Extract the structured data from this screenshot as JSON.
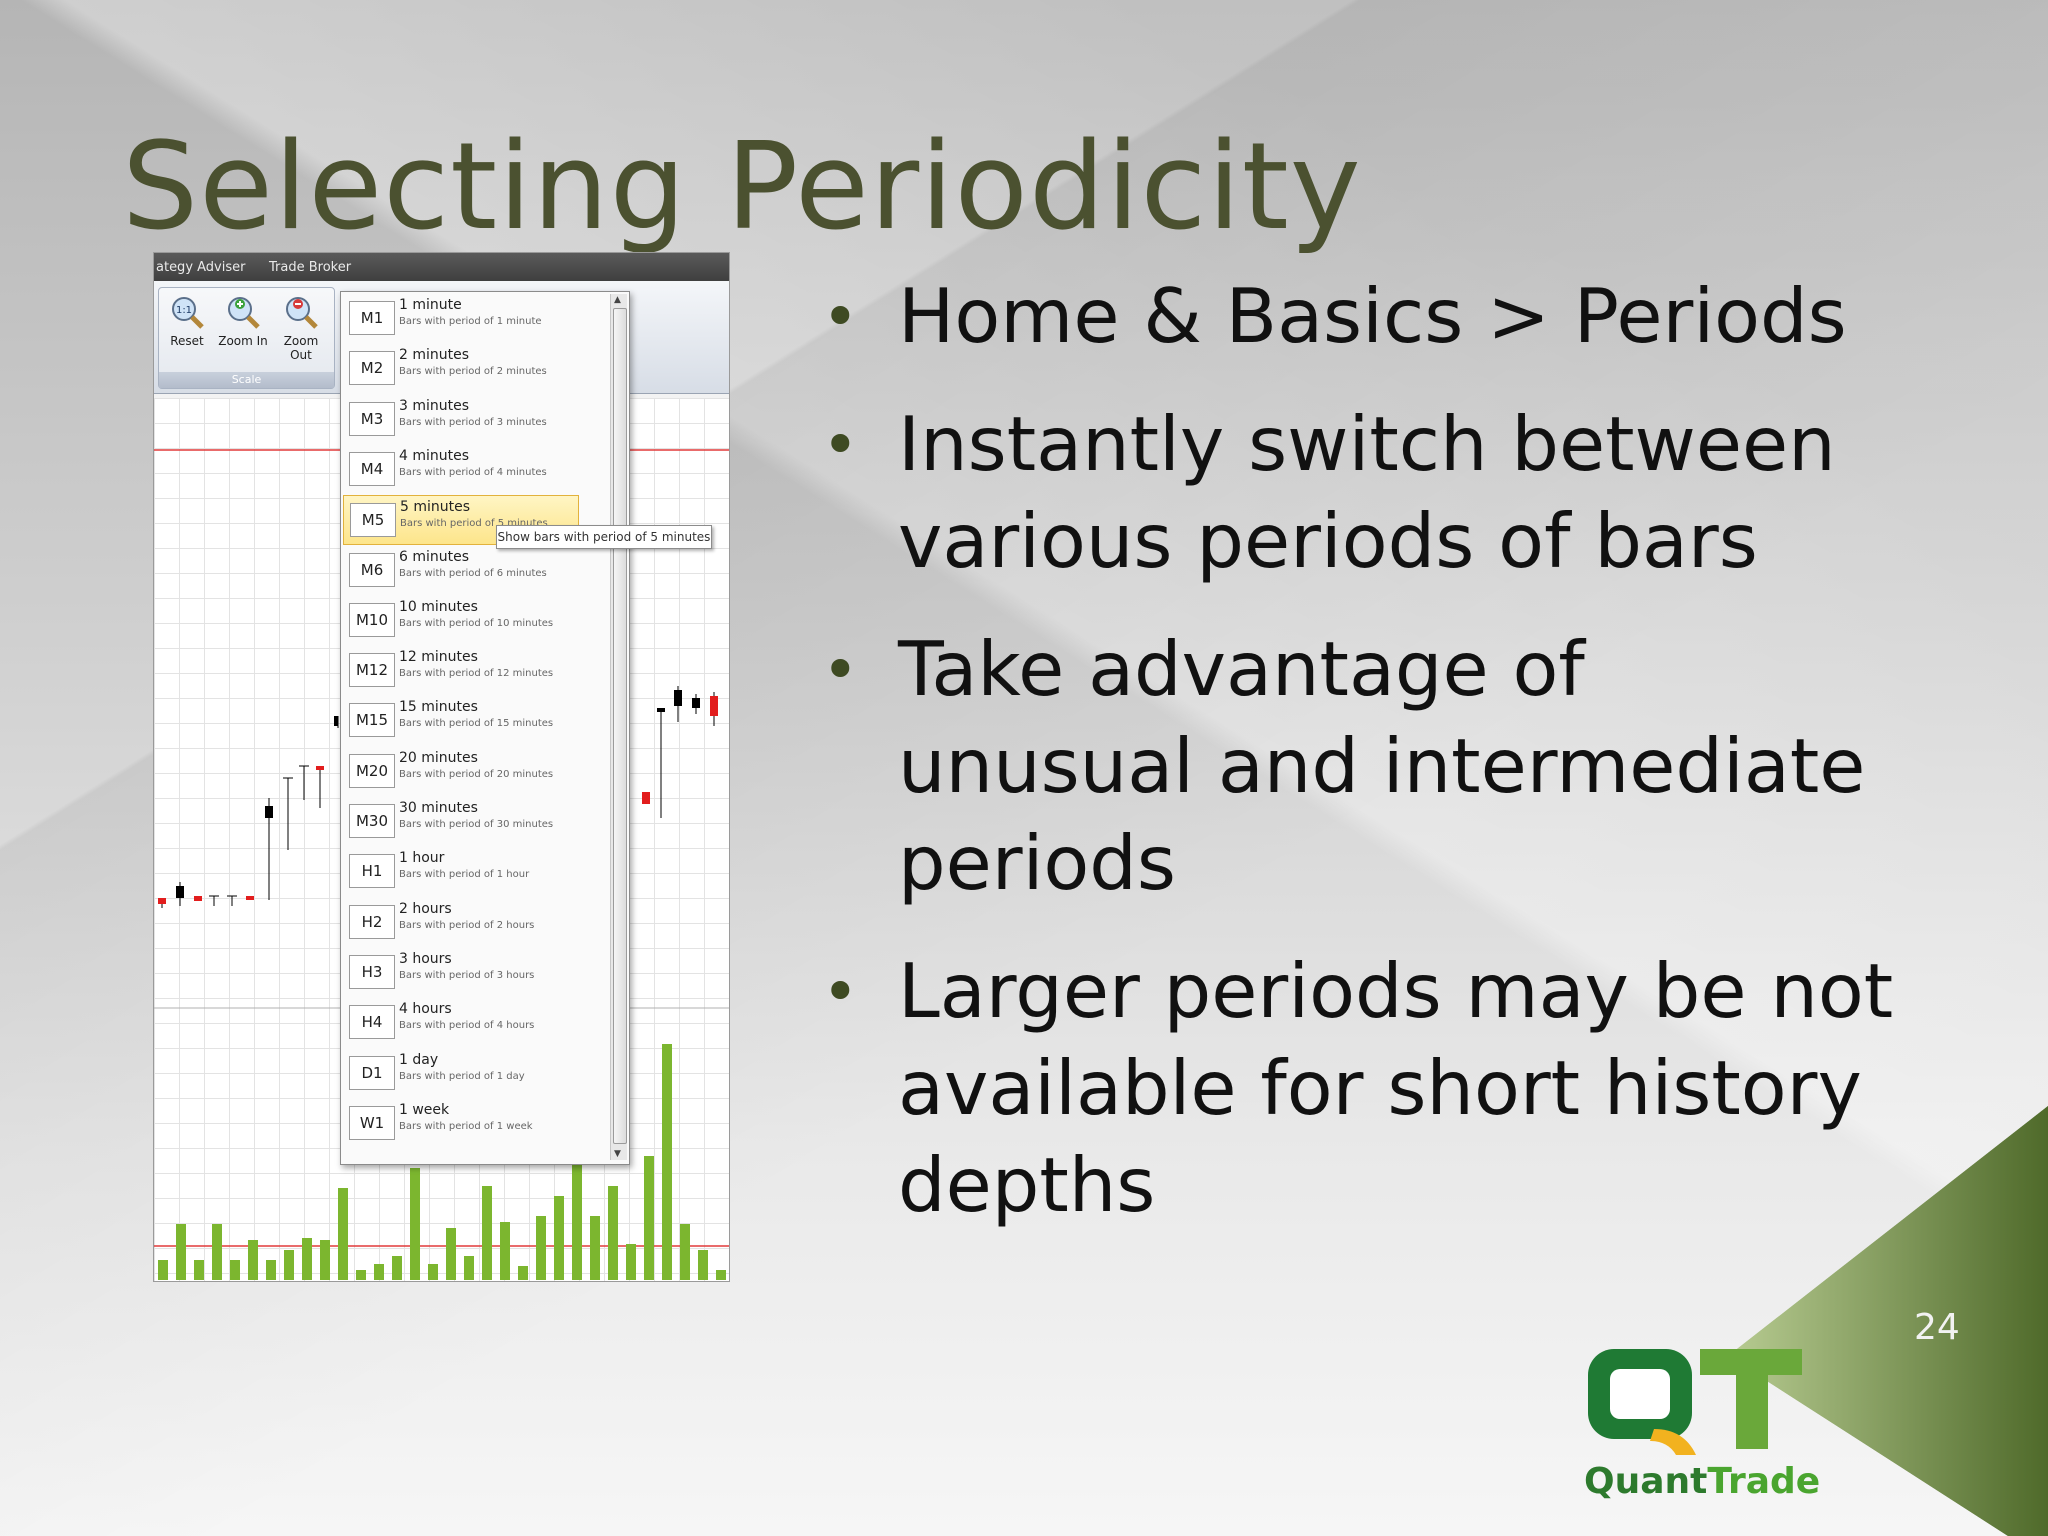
{
  "slide": {
    "title": "Selecting Periodicity",
    "page_number": "24",
    "bullets": [
      {
        "line1": "Home & Basics > Periods"
      },
      {
        "line1": "Instantly switch between",
        "line2": "various periods of bars"
      },
      {
        "line1": "Take advantage of",
        "line2": "unusual and intermediate",
        "line3": "periods"
      },
      {
        "line1": "Larger periods may be not",
        "line2": "available for short history",
        "line3": "depths"
      }
    ],
    "bullet_glyph": "•",
    "colors": {
      "title": "#4b5130",
      "accent_green": "#5f7a35"
    }
  },
  "logo": {
    "letters": "QT",
    "text_part1": "Quant",
    "text_part2": "Trade"
  },
  "screenshot": {
    "menubar": {
      "item1": "ategy Adviser",
      "item2": "Trade Broker"
    },
    "ribbon": {
      "reset_label": "Reset",
      "zoom_in_label": "Zoom In",
      "zoom_out_label": "Zoom Out",
      "group_label": "Scale",
      "reset_icon_text": "1:1"
    },
    "periods": [
      {
        "code": "M1",
        "name": "1 minute",
        "desc": "Bars with period of 1 minute"
      },
      {
        "code": "M2",
        "name": "2 minutes",
        "desc": "Bars with period of 2 minutes"
      },
      {
        "code": "M3",
        "name": "3 minutes",
        "desc": "Bars with period of 3 minutes"
      },
      {
        "code": "M4",
        "name": "4 minutes",
        "desc": "Bars with period of 4 minutes"
      },
      {
        "code": "M5",
        "name": "5 minutes",
        "desc": "Bars with period of 5 minutes",
        "selected": true
      },
      {
        "code": "M6",
        "name": "6 minutes",
        "desc": "Bars with period of 6 minutes"
      },
      {
        "code": "M10",
        "name": "10 minutes",
        "desc": "Bars with period of 10 minutes"
      },
      {
        "code": "M12",
        "name": "12 minutes",
        "desc": "Bars with period of 12 minutes"
      },
      {
        "code": "M15",
        "name": "15 minutes",
        "desc": "Bars with period of 15 minutes"
      },
      {
        "code": "M20",
        "name": "20 minutes",
        "desc": "Bars with period of 20 minutes"
      },
      {
        "code": "M30",
        "name": "30 minutes",
        "desc": "Bars with period of 30 minutes"
      },
      {
        "code": "H1",
        "name": "1 hour",
        "desc": "Bars with period of 1 hour"
      },
      {
        "code": "H2",
        "name": "2 hours",
        "desc": "Bars with period of 2 hours"
      },
      {
        "code": "H3",
        "name": "3 hours",
        "desc": "Bars with period of 3 hours"
      },
      {
        "code": "H4",
        "name": "4 hours",
        "desc": "Bars with period of 4 hours"
      },
      {
        "code": "D1",
        "name": "1 day",
        "desc": "Bars with period of 1 day"
      },
      {
        "code": "W1",
        "name": "1 week",
        "desc": "Bars with period of 1 week"
      }
    ],
    "tooltip": "Show bars with period of 5 minutes",
    "scroll_up_glyph": "▲",
    "scroll_down_glyph": "▼",
    "colors": {
      "volume": "#7cb62f",
      "bull": "#000000",
      "bear": "#e21d1d",
      "level_line": "#e23a3a"
    }
  }
}
